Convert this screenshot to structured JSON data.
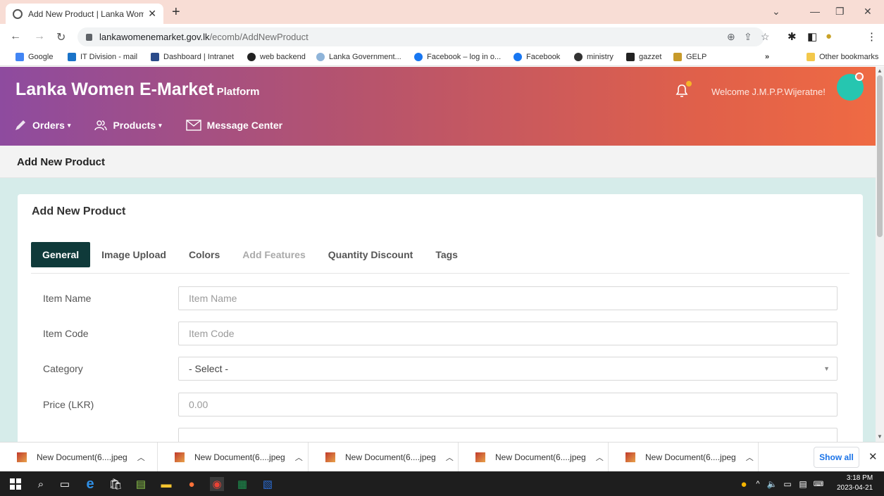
{
  "browser": {
    "tab_title": "Add New Product | Lanka Wome",
    "url_host": "lankawomenemarket.gov.lk",
    "url_path": "/ecomb/AddNewProduct",
    "bookmarks": [
      "Google",
      "IT Division - mail",
      "Dashboard | Intranet",
      "web backend",
      "Lanka Government...",
      "Facebook – log in o...",
      "Facebook",
      "ministry",
      "gazzet",
      "GELP"
    ],
    "other_bookmarks": "Other bookmarks",
    "overflow": "»"
  },
  "header": {
    "brand": "Lanka Women E-Market",
    "brand_suffix": "Platform",
    "welcome": "Welcome J.M.P.P.Wijeratne!",
    "nav": [
      {
        "label": "Orders",
        "icon": "pencil-icon",
        "caret": "▾"
      },
      {
        "label": "Products",
        "icon": "users-icon",
        "caret": "▾"
      },
      {
        "label": "Message Center",
        "icon": "envelope-icon",
        "caret": ""
      }
    ]
  },
  "page_title": "Add New Product",
  "card": {
    "title": "Add New Product",
    "tabs": [
      "General",
      "Image Upload",
      "Colors",
      "Add Features",
      "Quantity Discount",
      "Tags"
    ],
    "active_tab": "General",
    "fields": [
      {
        "label": "Item Name",
        "placeholder": "Item Name",
        "type": "text"
      },
      {
        "label": "Item Code",
        "placeholder": "Item Code",
        "type": "text"
      },
      {
        "label": "Category",
        "value": "- Select -",
        "type": "select"
      },
      {
        "label": "Price (LKR)",
        "placeholder": "0.00",
        "type": "text"
      }
    ]
  },
  "downloads": {
    "items": [
      "New Document(6....jpeg",
      "New Document(6....jpeg",
      "New Document(6....jpeg",
      "New Document(6....jpeg",
      "New Document(6....jpeg"
    ],
    "show_all": "Show all"
  },
  "taskbar": {
    "time": "3:18 PM",
    "date": "2023-04-21"
  },
  "colors": {
    "header_start": "#8e4b9f",
    "header_end": "#ef6a43",
    "active_tab": "#0f3a3a",
    "content_bg": "#d6ecea"
  }
}
